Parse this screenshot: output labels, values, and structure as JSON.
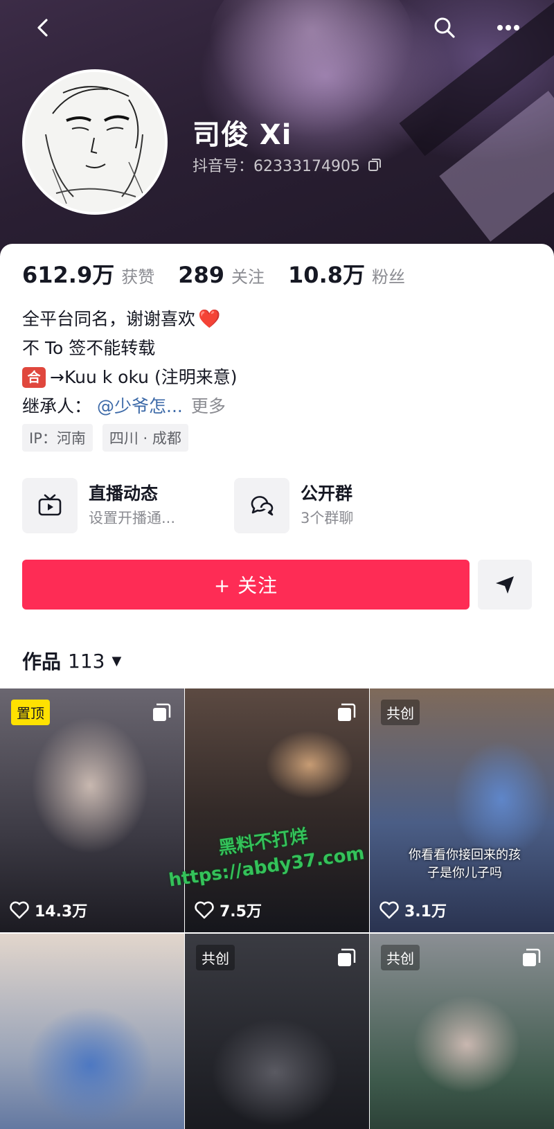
{
  "header": {
    "name": "司俊 Xi",
    "douyin_id_label": "抖音号：",
    "douyin_id": "62333174905"
  },
  "stats": [
    {
      "value": "612.9万",
      "label": "获赞"
    },
    {
      "value": "289",
      "label": "关注"
    },
    {
      "value": "10.8万",
      "label": "粉丝"
    }
  ],
  "bio": {
    "line1": "全平台同名，谢谢喜欢",
    "line1_emoji": "❤️",
    "line2": "不 To 签不能转载",
    "line3_badge": "合",
    "line3": "→Kuu  k oku (注明来意)",
    "line4_prefix": "继承人：",
    "line4_mention": "@少爷怎...",
    "line4_more": "更多"
  },
  "tags": [
    "IP：河南",
    "四川 · 成都"
  ],
  "features": [
    {
      "title": "直播动态",
      "subtitle": "设置开播通...",
      "icon": "tv-icon"
    },
    {
      "title": "公开群",
      "subtitle": "3个群聊",
      "icon": "chat-bubbles-icon"
    }
  ],
  "actions": {
    "follow_label": "+ 关注",
    "share_icon": "send-icon"
  },
  "works": {
    "label": "作品",
    "count": "113"
  },
  "videos": [
    {
      "badge": "置顶",
      "likes": "14.3万",
      "multi": true
    },
    {
      "badge": "",
      "likes": "7.5万",
      "multi": true
    },
    {
      "badge": "共创",
      "likes": "3.1万",
      "multi": false,
      "caption": "你看看你接回来的孩子是你儿子吗"
    },
    {
      "badge": "",
      "likes": "",
      "multi": false
    },
    {
      "badge": "共创",
      "likes": "",
      "multi": true
    },
    {
      "badge": "共创",
      "likes": "",
      "multi": true
    }
  ],
  "watermark": {
    "line1": "黑料不打烊",
    "line2": "https://abdy37.com"
  },
  "colors": {
    "follow_button": "#fe2c55",
    "pin_badge": "#fee101",
    "mention": "#3d6aa8"
  }
}
